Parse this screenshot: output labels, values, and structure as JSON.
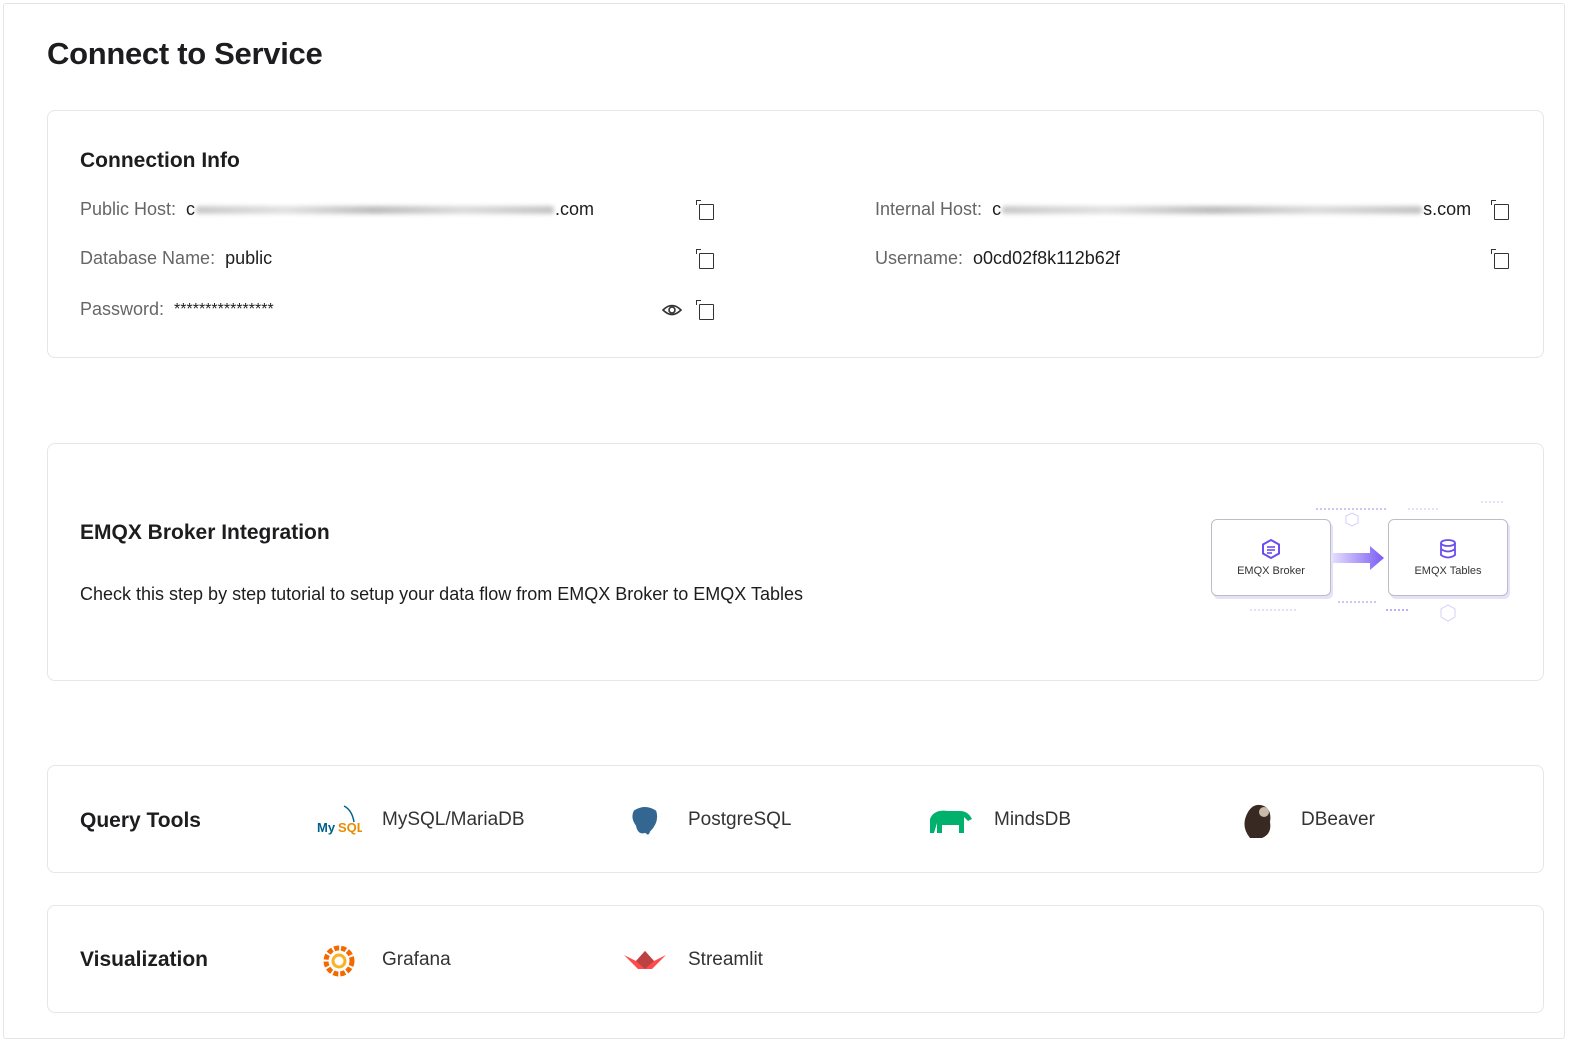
{
  "page": {
    "title": "Connect to Service"
  },
  "connection": {
    "title": "Connection Info",
    "public_host": {
      "label": "Public Host:",
      "prefix": "c",
      "suffix": ".com"
    },
    "database_name": {
      "label": "Database Name:",
      "value": "public"
    },
    "password": {
      "label": "Password:",
      "value": "****************"
    },
    "internal_host": {
      "label": "Internal Host:",
      "prefix": "c",
      "suffix": "s.com"
    },
    "username": {
      "label": "Username:",
      "value": "o0cd02f8k112b62f"
    }
  },
  "integration": {
    "title": "EMQX Broker Integration",
    "description": "Check this step by step tutorial to setup your data flow from EMQX Broker to EMQX Tables",
    "diagram": {
      "source": "EMQX Broker",
      "target": "EMQX Tables"
    }
  },
  "query_tools": {
    "title": "Query Tools",
    "items": [
      {
        "label": "MySQL/MariaDB",
        "icon": "mysql-logo"
      },
      {
        "label": "PostgreSQL",
        "icon": "postgresql-logo"
      },
      {
        "label": "MindsDB",
        "icon": "mindsdb-logo"
      },
      {
        "label": "DBeaver",
        "icon": "dbeaver-logo"
      }
    ]
  },
  "visualization": {
    "title": "Visualization",
    "items": [
      {
        "label": "Grafana",
        "icon": "grafana-logo"
      },
      {
        "label": "Streamlit",
        "icon": "streamlit-logo"
      }
    ]
  },
  "colors": {
    "accent": "#7b5cf5",
    "border": "#e6e6e6"
  }
}
